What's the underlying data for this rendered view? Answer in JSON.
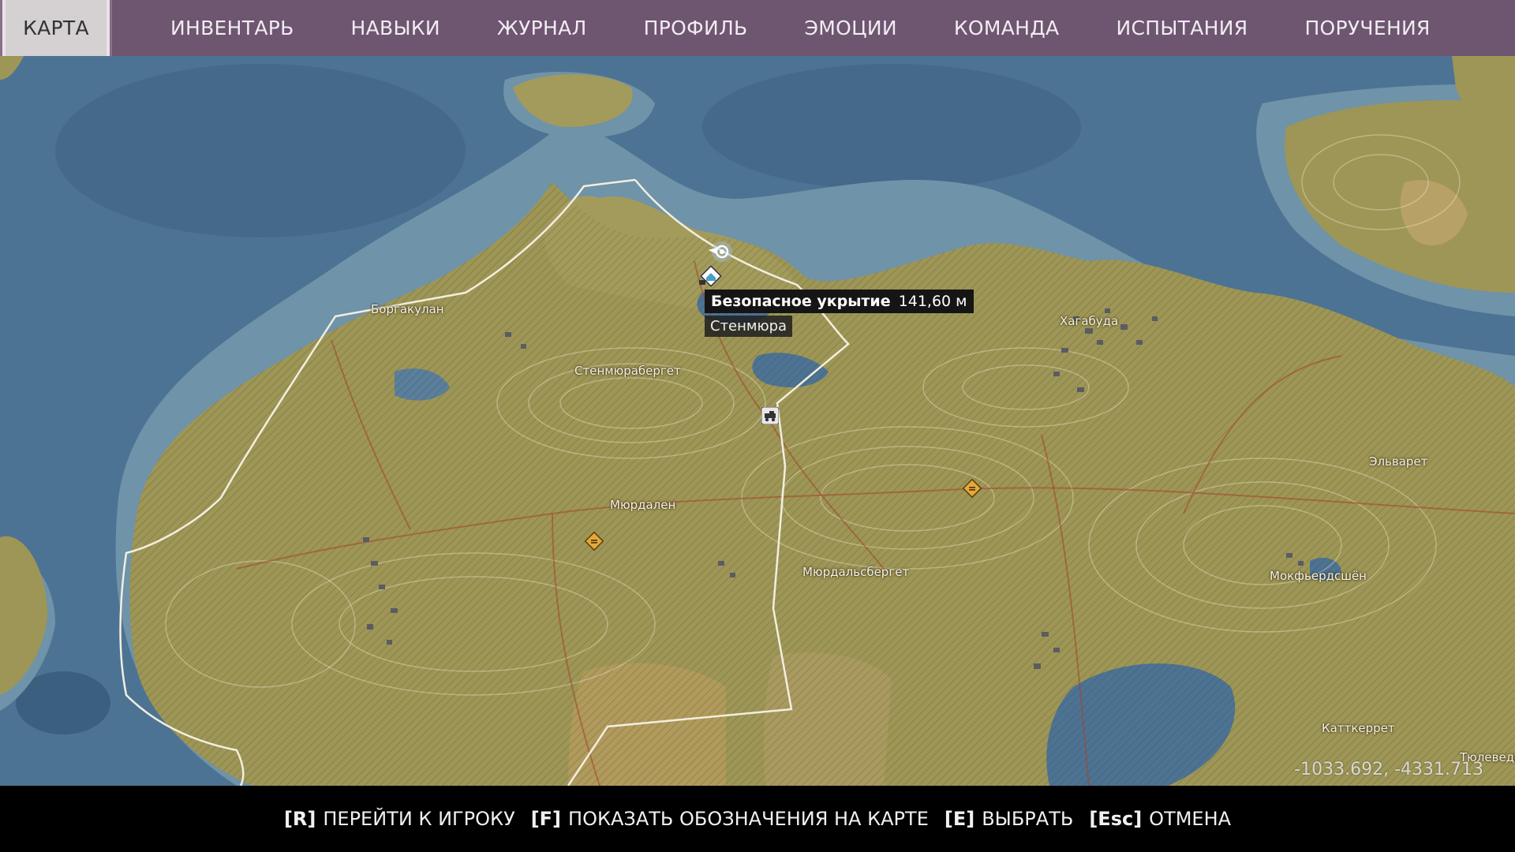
{
  "nav": {
    "active_tab": "КАРТА",
    "tabs": [
      "ИНВЕНТАРЬ",
      "НАВЫКИ",
      "ЖУРНАЛ",
      "ПРОФИЛЬ",
      "ЭМОЦИИ",
      "КОМАНДА",
      "ИСПЫТАНИЯ",
      "ПОРУЧЕНИЯ"
    ]
  },
  "map": {
    "places": [
      "Боргакулан",
      "Стенмюрабергет",
      "Хагабуда",
      "Мюрдален",
      "Мюрдальсбергет",
      "Эльварет",
      "Мокфьердсшён",
      "Катткеррет",
      "Тюлеведе"
    ],
    "tooltip": {
      "title": "Безопасное укрытие",
      "distance": "141,60 м",
      "region": "Стенмюра"
    },
    "coordinates": "-1033.692, -4331.713",
    "icons": {
      "player": "player-position-icon",
      "safehouse": "safehouse-icon",
      "vehicle": "vehicle-icon",
      "objective": "objective-diamond-icon"
    },
    "colors": {
      "water": "#4d7394",
      "shallow": "#6f93a8",
      "land": "#9e9656",
      "field": "#b09a5c",
      "border": "#f2eee0",
      "objective": "#e3a93a",
      "nav_bg": "#6e5570"
    }
  },
  "controls": [
    {
      "key": "[R]",
      "label": "ПЕРЕЙТИ К ИГРОКУ"
    },
    {
      "key": "[F]",
      "label": "ПОКАЗАТЬ ОБОЗНАЧЕНИЯ НА КАРТЕ"
    },
    {
      "key": "[E]",
      "label": "ВЫБРАТЬ"
    },
    {
      "key": "[Esc]",
      "label": "ОТМЕНА"
    }
  ]
}
